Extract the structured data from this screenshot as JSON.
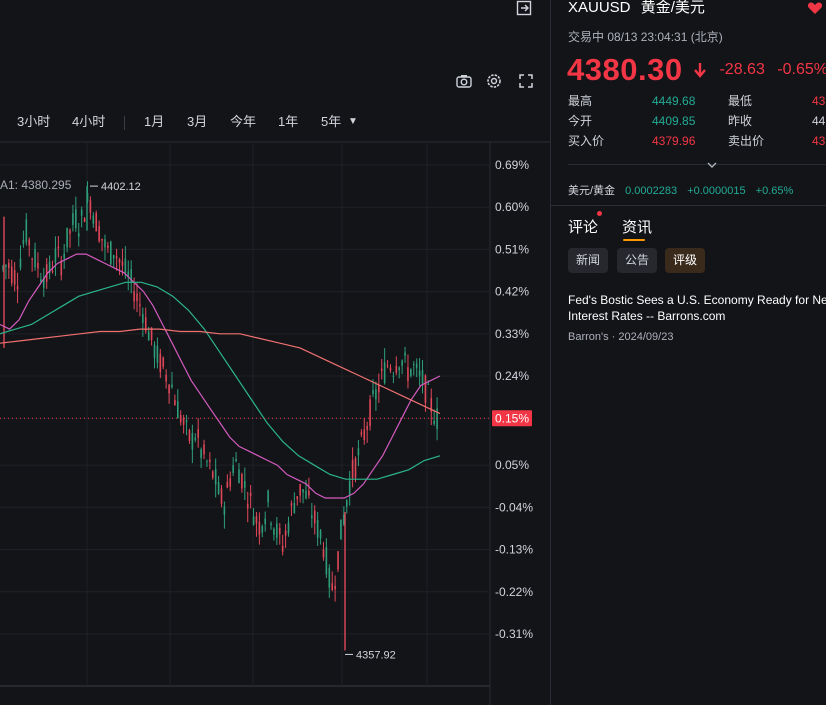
{
  "toolbar": {
    "ranges": [
      "3小时",
      "4小时",
      "1月",
      "3月",
      "今年",
      "1年",
      "5年"
    ],
    "icons": [
      "exit-icon",
      "camera-icon",
      "settings-icon",
      "fullscreen-icon",
      "chevron-down-icon"
    ]
  },
  "chart_data": {
    "type": "line",
    "title": "",
    "xlabel": "",
    "ylabel": "",
    "y_ticks": [
      "0.69%",
      "0.60%",
      "0.51%",
      "0.42%",
      "0.33%",
      "0.24%",
      "0.15%",
      "0.05%",
      "-0.04%",
      "-0.13%",
      "-0.22%",
      "-0.31%"
    ],
    "ylim": [
      -0.36,
      0.72
    ],
    "current_change_label": "0.15%",
    "current_change_value": 0.15,
    "ma_label": "A1: 4380.295",
    "high_label": "4402.12",
    "high_value": 0.645,
    "low_label": "4357.92",
    "low_value": -0.345,
    "grid": true,
    "series": [
      {
        "values": [
          0.47,
          0.48,
          0.46,
          0.45,
          0.52,
          0.55,
          0.5,
          0.48,
          0.46,
          0.45,
          0.47,
          0.5,
          0.48,
          0.52,
          0.55,
          0.58,
          0.56,
          0.6,
          0.62,
          0.58,
          0.55,
          0.52,
          0.5,
          0.51,
          0.49,
          0.47,
          0.45,
          0.43,
          0.4,
          0.38,
          0.34,
          0.31,
          0.28,
          0.26,
          0.24,
          0.22,
          0.18,
          0.15,
          0.12,
          0.1,
          0.12,
          0.08,
          0.06,
          0.04,
          0.02,
          -0.02,
          -0.03,
          0.02,
          0.06,
          0.04,
          0.01,
          -0.02,
          -0.05,
          -0.08,
          -0.06,
          -0.03,
          -0.07,
          -0.1,
          -0.12,
          -0.08,
          -0.04,
          -0.01,
          0.0,
          -0.02,
          -0.05,
          -0.08,
          -0.1,
          -0.15,
          -0.22,
          -0.18,
          -0.1,
          -0.04,
          0.02,
          0.05,
          0.08,
          0.12,
          0.16,
          0.19,
          0.22,
          0.25,
          0.27,
          0.26,
          0.28,
          0.27,
          0.25,
          0.26,
          0.24,
          0.23,
          0.2,
          0.17,
          0.15
        ],
        "color": "#2e9e79"
      },
      {
        "values": [
          0.35,
          0.34,
          0.36,
          0.4,
          0.43,
          0.46,
          0.48,
          0.49,
          0.5,
          0.5,
          0.49,
          0.48,
          0.47,
          0.46,
          0.44,
          0.42,
          0.39,
          0.35,
          0.31,
          0.27,
          0.23,
          0.2,
          0.17,
          0.14,
          0.11,
          0.09,
          0.08,
          0.07,
          0.06,
          0.05,
          0.03,
          0.02,
          0.01,
          -0.01,
          -0.02,
          -0.02,
          -0.02,
          -0.01,
          0.01,
          0.04,
          0.07,
          0.11,
          0.15,
          0.19,
          0.22,
          0.23,
          0.24
        ],
        "color": "#d45bbf"
      },
      {
        "values": [
          0.33,
          0.34,
          0.35,
          0.37,
          0.39,
          0.41,
          0.42,
          0.43,
          0.44,
          0.44,
          0.43,
          0.41,
          0.38,
          0.34,
          0.29,
          0.24,
          0.19,
          0.14,
          0.1,
          0.07,
          0.05,
          0.03,
          0.02,
          0.02,
          0.02,
          0.03,
          0.04,
          0.06,
          0.07
        ],
        "color": "#2bb58a"
      },
      {
        "values": [
          0.31,
          0.315,
          0.32,
          0.325,
          0.33,
          0.335,
          0.335,
          0.34,
          0.34,
          0.335,
          0.335,
          0.33,
          0.33,
          0.32,
          0.31,
          0.3,
          0.28,
          0.26,
          0.24,
          0.22,
          0.2,
          0.18,
          0.16
        ],
        "color": "#f07070"
      }
    ]
  },
  "quote": {
    "symbol": "XAUUSD",
    "name": "黄金/美元",
    "status": "交易中 08/13 23:04:31 (北京)",
    "price": "4380.30",
    "change": "-28.63",
    "change_pct": "-0.65%",
    "stats": [
      {
        "label": "最高",
        "value": "4449.68",
        "label2": "最低",
        "value2": "43"
      },
      {
        "label": "今开",
        "value": "4409.85",
        "label2": "昨收",
        "value2": "44"
      },
      {
        "label": "买入价",
        "value": "4379.96",
        "label2": "卖出价",
        "value2": "43"
      }
    ],
    "related": {
      "name": "美元/黄金",
      "price": "0.0002283",
      "change": "+0.0000015",
      "change_pct": "+0.65%"
    }
  },
  "tabs": [
    "评论",
    "资讯"
  ],
  "subtabs": [
    "新闻",
    "公告",
    "评级"
  ],
  "news": [
    {
      "title": "Fed's Bostic Sees a U.S. Economy Ready for Neutral Interest Rates -- Barrons.com",
      "meta": "Barron's · 2024/09/23"
    }
  ],
  "colors": {
    "up": "#22ab94",
    "down": "#f23645",
    "background": "#131418",
    "accent": "#ff9800"
  }
}
